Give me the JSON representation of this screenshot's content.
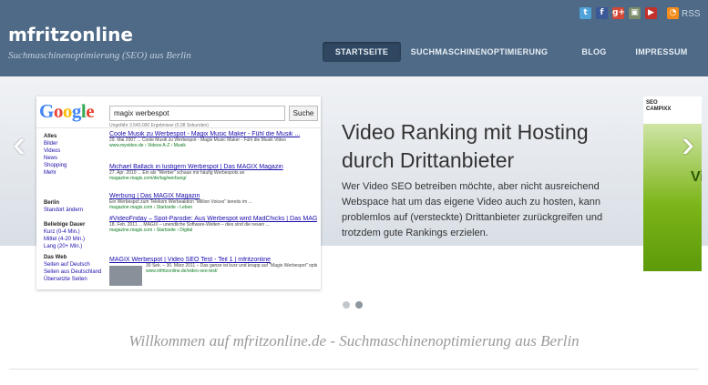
{
  "site": {
    "title": "mfritzonline",
    "tagline": "Suchmaschinenoptimierung (SEO) aus Berlin",
    "rss_label": "RSS"
  },
  "social": [
    {
      "name": "twitter",
      "glyph": "t",
      "color": "#4fa3d9"
    },
    {
      "name": "facebook",
      "glyph": "f",
      "color": "#3b5998"
    },
    {
      "name": "googleplus",
      "glyph": "g+",
      "color": "#d34836"
    },
    {
      "name": "picture",
      "glyph": "▣",
      "color": "#7d8c6a"
    },
    {
      "name": "youtube",
      "glyph": "▶",
      "color": "#c4302b"
    },
    {
      "name": "rss",
      "glyph": "◔",
      "color": "#f48c1b"
    }
  ],
  "nav": {
    "items": [
      "STARTSEITE",
      "SUCHMASCHINENOPTIMIERUNG",
      "BLOG",
      "IMPRESSUM"
    ],
    "active": "STARTSEITE"
  },
  "slider": {
    "title": "Video Ranking mit Hosting durch Drittanbieter",
    "text": "Wer Video SEO betreiben möchte, aber nicht ausreichend Webspace hat um das eigene Video auch zu hosten, kann problemlos auf (versteckte) Drittanbieter zurückgreifen und trotzdem gute Rankings erzielen.",
    "prev_arrow": "‹",
    "next_arrow": "›",
    "dots": 2,
    "active_dot": 2
  },
  "screenshot": {
    "logo": "Google",
    "query": "magix werbespot",
    "button": "Suche",
    "stats": "Ungefähr 3.540.000 Ergebnisse (0,08 Sekunden)",
    "side_types": [
      "Alles",
      "Bilder",
      "Videos",
      "News",
      "Shopping",
      "Mehr"
    ],
    "side_loc_title": "Berlin",
    "side_loc_link": "Standort ändern",
    "side_time_title": "Beliebige Dauer",
    "side_time": [
      "Kurz (0-4 Min.)",
      "Mittel (4-20 Min.)",
      "Lang (20+ Min.)"
    ],
    "side_web_title": "Das Web",
    "side_web": [
      "Seiten auf Deutsch",
      "Seiten aus Deutschland",
      "Übersetzte Seiten"
    ],
    "results": [
      {
        "title": "Coole Musik zu Werbespot - Magix Music Maker - Fühl die Musik ...",
        "snippet": "29. Mai 2007 ... Coole Musik zu Werbespot - Magix Music Maker - Fühl die Musik Video",
        "url": "www.myvideo.de › Videos A-Z › Musik"
      },
      {
        "title": "Michael Ballack in lustigem Werbespot | Das MAGIX Magazin",
        "snippet": "27. Apr. 2010 ... Ein als \"Werber\" schaue mir häufig Werbespots an",
        "url": "magazine.magix.com/de/tag/werbung/"
      },
      {
        "title": "Werbung | Das MAGIX Magazin",
        "snippet": "Ein Werbespot zum Telekom Werbeaktion \"Million Voices\" bereits im ...",
        "url": "magazine.magix.com › Startseite › Leben"
      },
      {
        "title": "#VideoFriday – Spot-Parodie: Aus Werbespot wird MadChicks | Das MAGIX",
        "snippet": "18. Feb. 2011 ... MAGIX – unendliche Software-Welten – dies sind die neuen ...",
        "url": "magazine.magix.com › Startseite › Digital"
      },
      {
        "title": "MAGIX Werbespot | Video SEO Test - Teil 1 | mfritzonline",
        "snippet": "30 Sek. – 30. März 2011 – Das ganze ist kurz und knapp auf \"Magix Werbespot\" optimiert",
        "url": "www.mfritzonline.de/video-seo-test/"
      }
    ]
  },
  "ad": {
    "brand": "SEO CAMPIXX",
    "accent": "#7cb518"
  },
  "welcome": "Willkommen auf mfritzonline.de - Suchmaschinenoptimierung aus Berlin"
}
